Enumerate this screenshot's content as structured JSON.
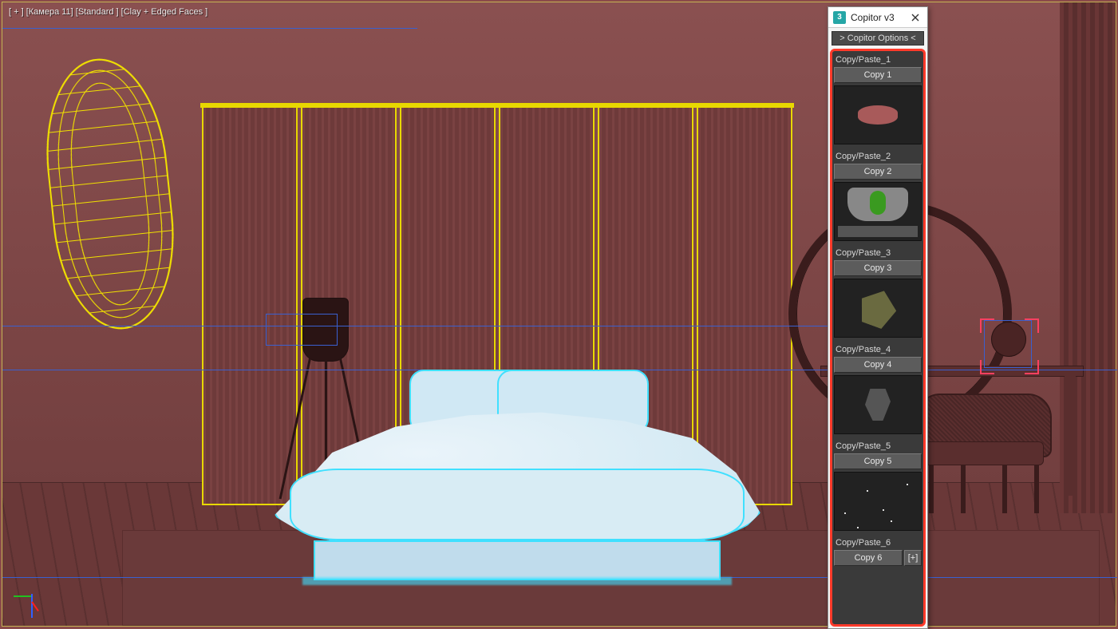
{
  "viewport": {
    "label": "[ + ] [Камера 11] [Standard ] [Clay + Edged Faces ]"
  },
  "panel": {
    "title": "Copitor v3",
    "options_label": "> Copitor Options <",
    "slots": [
      {
        "label": "Copy/Paste_1",
        "button": "Copy 1",
        "has_plus": false,
        "thumb": "th1"
      },
      {
        "label": "Copy/Paste_2",
        "button": "Copy 2",
        "has_plus": false,
        "thumb": "th2"
      },
      {
        "label": "Copy/Paste_3",
        "button": "Copy 3",
        "has_plus": false,
        "thumb": "th3"
      },
      {
        "label": "Copy/Paste_4",
        "button": "Copy 4",
        "has_plus": false,
        "thumb": "th4"
      },
      {
        "label": "Copy/Paste_5",
        "button": "Copy 5",
        "has_plus": false,
        "thumb": "th5"
      },
      {
        "label": "Copy/Paste_6",
        "button": "Copy 6",
        "has_plus": true,
        "thumb": ""
      }
    ],
    "plus_label": "[+]"
  }
}
